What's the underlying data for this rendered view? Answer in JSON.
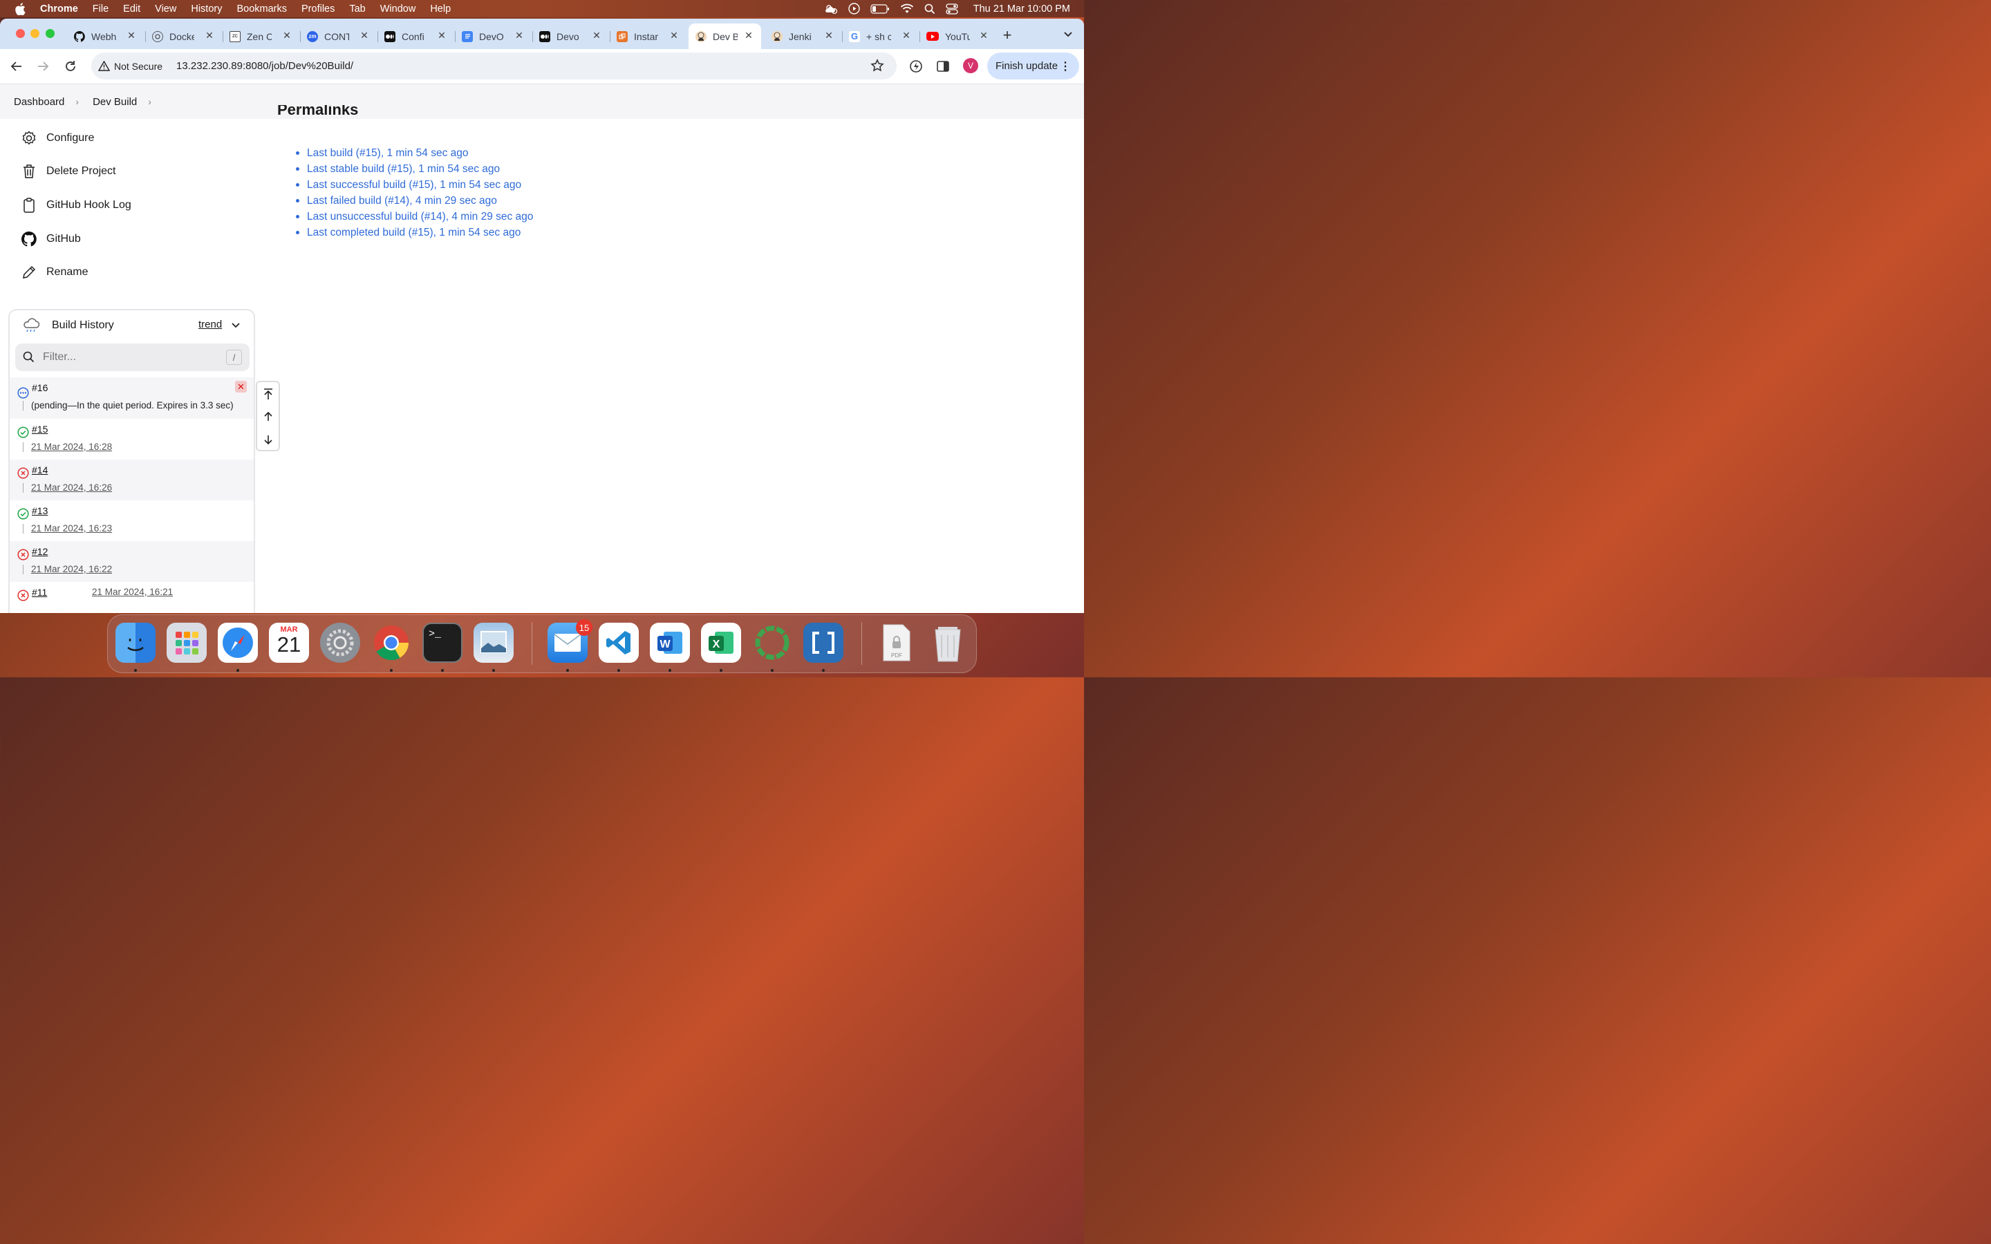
{
  "menubar": {
    "app": "Chrome",
    "items": [
      "File",
      "Edit",
      "View",
      "History",
      "Bookmarks",
      "Profiles",
      "Tab",
      "Window",
      "Help"
    ],
    "clock": "Thu 21 Mar  10:00 PM"
  },
  "tabs": [
    {
      "title": "Webh",
      "icon": "github-icon"
    },
    {
      "title": "Docke",
      "icon": "chatgpt-icon"
    },
    {
      "title": "Zen C",
      "icon": "zen-class-icon"
    },
    {
      "title": "CONT",
      "icon": "zoom-icon"
    },
    {
      "title": "Confi",
      "icon": "medium-icon"
    },
    {
      "title": "DevO",
      "icon": "google-docs-icon"
    },
    {
      "title": "Devo",
      "icon": "medium-icon"
    },
    {
      "title": "Instar",
      "icon": "aws-icon"
    },
    {
      "title": "Dev B",
      "icon": "jenkins-icon",
      "active": true
    },
    {
      "title": "Jenki",
      "icon": "jenkins-icon"
    },
    {
      "title": "+ sh c",
      "icon": "google-icon"
    },
    {
      "title": "YouTu",
      "icon": "youtube-icon"
    }
  ],
  "toolbar": {
    "security": "Not Secure",
    "url": "13.232.230.89:8080/job/Dev%20Build/",
    "avatar": "V",
    "finish_update": "Finish update"
  },
  "breadcrumb": [
    "Dashboard",
    "Dev Build"
  ],
  "sidebar": {
    "items": [
      {
        "label": "Configure",
        "icon": "gear-icon"
      },
      {
        "label": "Delete Project",
        "icon": "trash-icon"
      },
      {
        "label": "GitHub Hook Log",
        "icon": "clipboard-icon"
      },
      {
        "label": "GitHub",
        "icon": "github-icon"
      },
      {
        "label": "Rename",
        "icon": "pencil-icon"
      }
    ]
  },
  "permalinks": {
    "title": "Permalinks",
    "links": [
      "Last build (#15), 1 min 54 sec ago",
      "Last stable build (#15), 1 min 54 sec ago",
      "Last successful build (#15), 1 min 54 sec ago",
      "Last failed build (#14), 4 min 29 sec ago",
      "Last unsuccessful build (#14), 4 min 29 sec ago",
      "Last completed build (#15), 1 min 54 sec ago"
    ]
  },
  "build_history": {
    "title": "Build History",
    "trend": "trend",
    "filter_placeholder": "Filter...",
    "filter_shortcut": "/",
    "builds": [
      {
        "number": "#16",
        "status": "pending",
        "detail": "(pending—In the quiet period. Expires in 3.3 sec)"
      },
      {
        "number": "#15",
        "status": "success",
        "detail": "21 Mar 2024, 16:28"
      },
      {
        "number": "#14",
        "status": "failed",
        "detail": "21 Mar 2024, 16:26"
      },
      {
        "number": "#13",
        "status": "success",
        "detail": "21 Mar 2024, 16:23"
      },
      {
        "number": "#12",
        "status": "failed",
        "detail": "21 Mar 2024, 16:22"
      },
      {
        "number": "#11",
        "status": "failed",
        "detail": "21 Mar 2024, 16:21"
      }
    ]
  },
  "dock": {
    "apps": [
      "Finder",
      "Launchpad",
      "Safari",
      "Calendar",
      "System Settings",
      "Chrome",
      "Terminal",
      "Preview",
      "Mail",
      "VS Code",
      "Word",
      "Excel",
      "Activity",
      "Brackets",
      "Documents",
      "Trash"
    ],
    "calendar_month": "MAR",
    "calendar_day": "21",
    "mail_badge": "15"
  },
  "colors": {
    "link": "#2f6bd8",
    "success": "#1ea446",
    "failed": "#e03131",
    "pending": "#2f6bd8",
    "tabstrip": "#d4e2f5"
  }
}
